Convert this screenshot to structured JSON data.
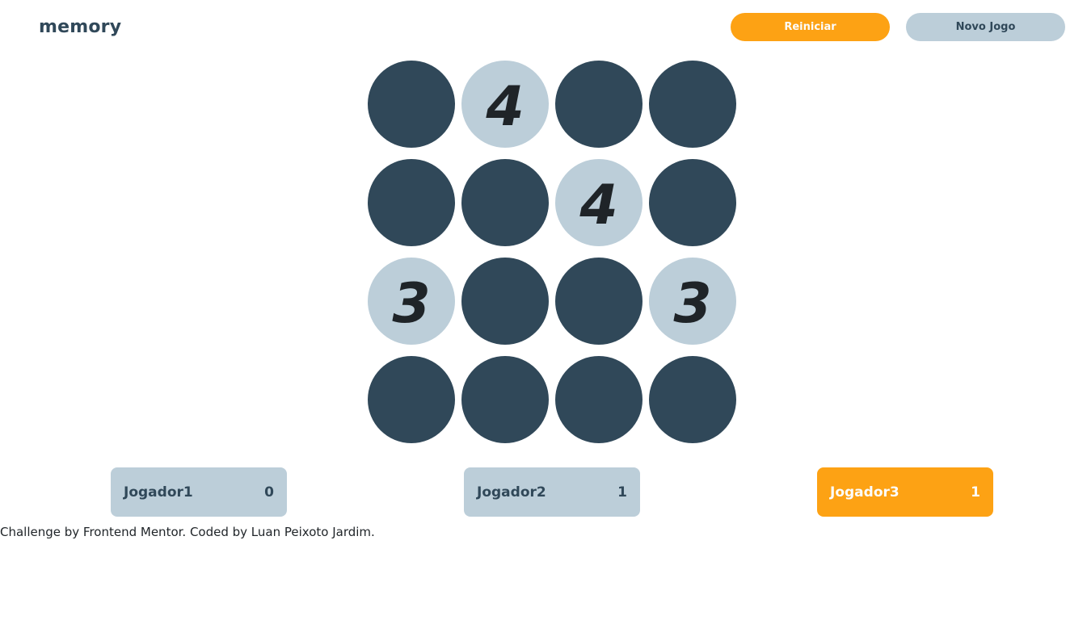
{
  "header": {
    "logo": "memory",
    "restart_label": "Reiniciar",
    "new_game_label": "Novo Jogo"
  },
  "board": {
    "size": "4x4",
    "tiles": [
      {
        "value": "",
        "revealed": false
      },
      {
        "value": "4",
        "revealed": true
      },
      {
        "value": "",
        "revealed": false
      },
      {
        "value": "",
        "revealed": false
      },
      {
        "value": "",
        "revealed": false
      },
      {
        "value": "",
        "revealed": false
      },
      {
        "value": "4",
        "revealed": true
      },
      {
        "value": "",
        "revealed": false
      },
      {
        "value": "3",
        "revealed": true
      },
      {
        "value": "",
        "revealed": false
      },
      {
        "value": "",
        "revealed": false
      },
      {
        "value": "3",
        "revealed": true
      },
      {
        "value": "",
        "revealed": false
      },
      {
        "value": "",
        "revealed": false
      },
      {
        "value": "",
        "revealed": false
      },
      {
        "value": "",
        "revealed": false
      }
    ]
  },
  "players": [
    {
      "name": "Jogador1",
      "score": "0",
      "active": false
    },
    {
      "name": "Jogador2",
      "score": "1",
      "active": false
    },
    {
      "name": "Jogador3",
      "score": "1",
      "active": true
    }
  ],
  "footer": {
    "text": "Challenge by Frontend Mentor. Coded by Luan Peixoto Jardim."
  },
  "colors": {
    "accent": "#FDA214",
    "dark": "#304859",
    "light": "#BCCED9",
    "background": "#FFFFFF"
  }
}
